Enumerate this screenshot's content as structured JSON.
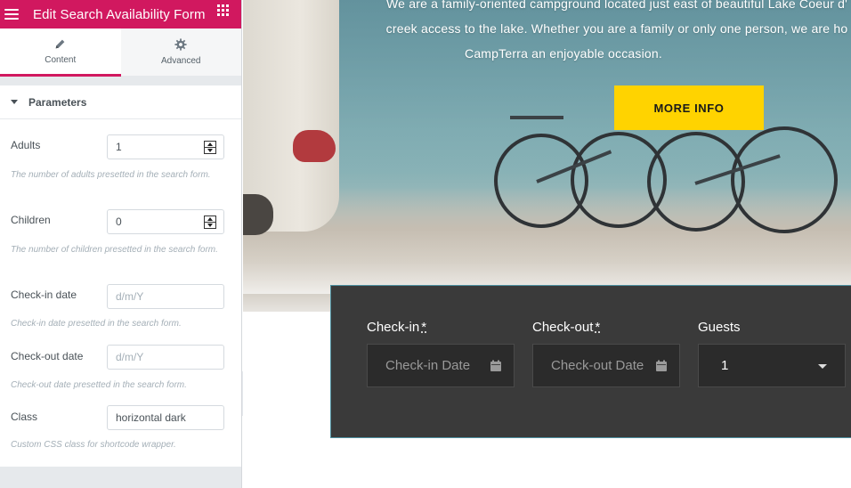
{
  "panel": {
    "title": "Edit Search Availability Form",
    "tabs": [
      {
        "label": "Content",
        "icon": "pencil-icon"
      },
      {
        "label": "Advanced",
        "icon": "gear-icon"
      }
    ],
    "section_title": "Parameters",
    "controls": [
      {
        "label": "Adults",
        "value": "1",
        "placeholder": "",
        "description": "The number of adults presetted in the search form."
      },
      {
        "label": "Children",
        "value": "0",
        "placeholder": "",
        "description": "The number of children presetted in the search form."
      },
      {
        "label": "Check-in date",
        "value": "",
        "placeholder": "d/m/Y",
        "description": "Check-in date presetted in the search form."
      },
      {
        "label": "Check-out date",
        "value": "",
        "placeholder": "d/m/Y",
        "description": "Check-out date presetted in the search form."
      },
      {
        "label": "Class",
        "value": "horizontal dark",
        "placeholder": "",
        "description": "Custom CSS class for shortcode wrapper."
      }
    ]
  },
  "hero": {
    "line1": "We are a family-oriented campground located just east of beautiful Lake Coeur d'",
    "line2": "creek access to the lake. Whether you are a family or only one person, we are ho",
    "line3": "CampTerra an enjoyable occasion.",
    "button_label": "MORE INFO",
    "button_color": "#ffd300"
  },
  "search_form": {
    "checkin_label": "Check-in",
    "checkout_label": "Check-out",
    "guests_label": "Guests",
    "required_mark": "*",
    "checkin_placeholder": "Check-in Date",
    "checkout_placeholder": "Check-out Date",
    "guests_value": "1"
  },
  "colors": {
    "accent": "#d1185f",
    "form_background": "#3a3a3a"
  }
}
